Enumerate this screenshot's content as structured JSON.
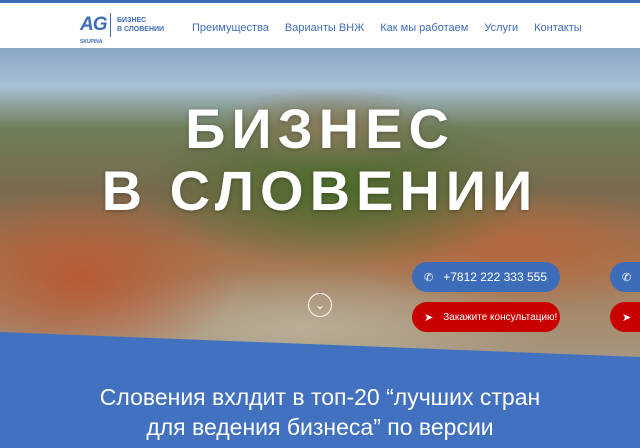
{
  "header": {
    "logo_main": "AG",
    "logo_sub": "SKUPINA",
    "logo_line1": "БИЗНЕС",
    "logo_line2": "В СЛОВЕНИИ",
    "nav": [
      "Преимущества",
      "Варианты ВНЖ",
      "Как мы работаем",
      "Услуги",
      "Контакты"
    ]
  },
  "hero": {
    "title_line1": "БИЗНЕС",
    "title_line2": "В СЛОВЕНИИ",
    "phone": "+7812 222 333 555",
    "consult": "Закажите  консультацию!"
  },
  "info": {
    "line1": "Словения вхлдит в топ-20 “лучших стран",
    "line2": "для ведения бизнеса” по версии"
  },
  "colors": {
    "brand": "#3d6db8",
    "accent": "#c90000",
    "section": "#4272bf"
  }
}
